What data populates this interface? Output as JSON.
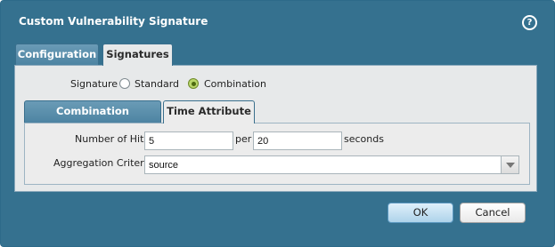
{
  "dialog": {
    "title": "Custom Vulnerability Signature",
    "help_icon": "?"
  },
  "tabs": [
    {
      "label": "Configuration",
      "active": false
    },
    {
      "label": "Signatures",
      "active": true
    }
  ],
  "signature": {
    "label": "Signature",
    "options": [
      {
        "label": "Standard",
        "selected": false
      },
      {
        "label": "Combination",
        "selected": true
      }
    ]
  },
  "subtabs": [
    {
      "label": "Combination Signatures",
      "active": false
    },
    {
      "label": "Time Attribute",
      "active": true
    }
  ],
  "time_attribute": {
    "hits_label": "Number of Hits",
    "hits_value": "5",
    "per_label": "per",
    "per_value": "20",
    "seconds_label": "seconds",
    "aggregation_label": "Aggregation Criteria",
    "aggregation_value": "source"
  },
  "buttons": {
    "ok": "OK",
    "cancel": "Cancel"
  },
  "colors": {
    "dialog_bg": "#35718f",
    "panel_bg": "#e7e9ea",
    "radio_checked": "#b9d66a"
  }
}
